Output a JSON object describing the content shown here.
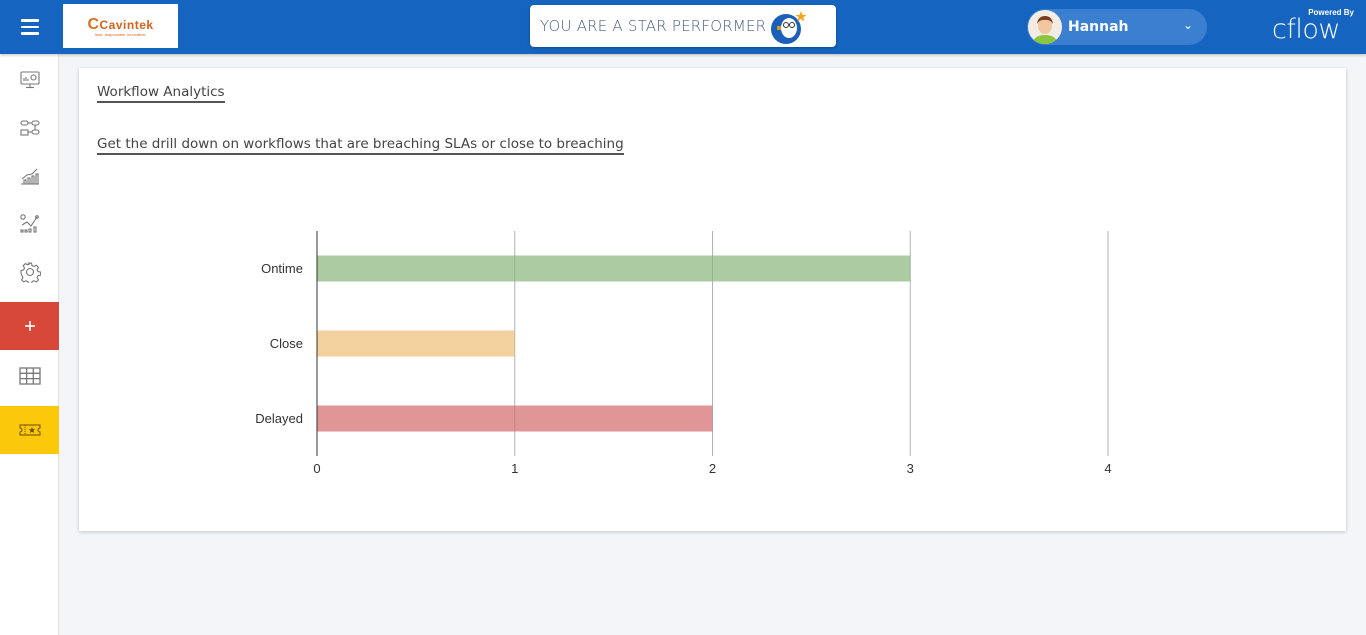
{
  "header": {
    "menu_icon": "hamburger-menu-icon",
    "logo": {
      "name": "Cavintek",
      "tagline": "trust. responsible. innovative."
    },
    "banner_text": "YOU ARE A STAR PERFORMER",
    "banner_icon": "star-performer-mascot-icon",
    "user": {
      "name": "Hannah",
      "avatar_icon": "user-avatar-icon"
    },
    "powered_by": "Powered By",
    "brand": "cflow",
    "colors": {
      "topbar": "#1565c0",
      "user_pill": "#3a7fd0"
    }
  },
  "sidebar": {
    "items": [
      {
        "name": "dashboard",
        "icon": "monitor-dashboard-icon"
      },
      {
        "name": "workflows",
        "icon": "workflow-diagram-icon"
      },
      {
        "name": "reports",
        "icon": "bar-chart-growth-icon"
      },
      {
        "name": "analytics",
        "icon": "analytics-icon"
      },
      {
        "name": "settings",
        "icon": "gear-icon"
      },
      {
        "name": "add",
        "icon": "plus-icon",
        "label": "+"
      },
      {
        "name": "table",
        "icon": "table-grid-icon"
      },
      {
        "name": "rewards",
        "icon": "star-ticket-icon"
      }
    ],
    "colors": {
      "add": "#d84838",
      "rewards": "#fcc80a"
    }
  },
  "card": {
    "title": "Workflow Analytics",
    "subtitle": "Get the drill down on workflows that are breaching SLAs or close to breaching"
  },
  "chart_data": {
    "type": "bar",
    "orientation": "horizontal",
    "title": "",
    "xlabel": "",
    "ylabel": "",
    "categories": [
      "Ontime",
      "Close",
      "Delayed"
    ],
    "values": [
      3,
      1,
      2
    ],
    "colors": [
      "#adcba3",
      "#f2d19e",
      "#e09597"
    ],
    "xlim": [
      0,
      4
    ],
    "x_ticks": [
      "0",
      "1",
      "2",
      "3",
      "4"
    ],
    "grid": true,
    "legend": "none"
  }
}
